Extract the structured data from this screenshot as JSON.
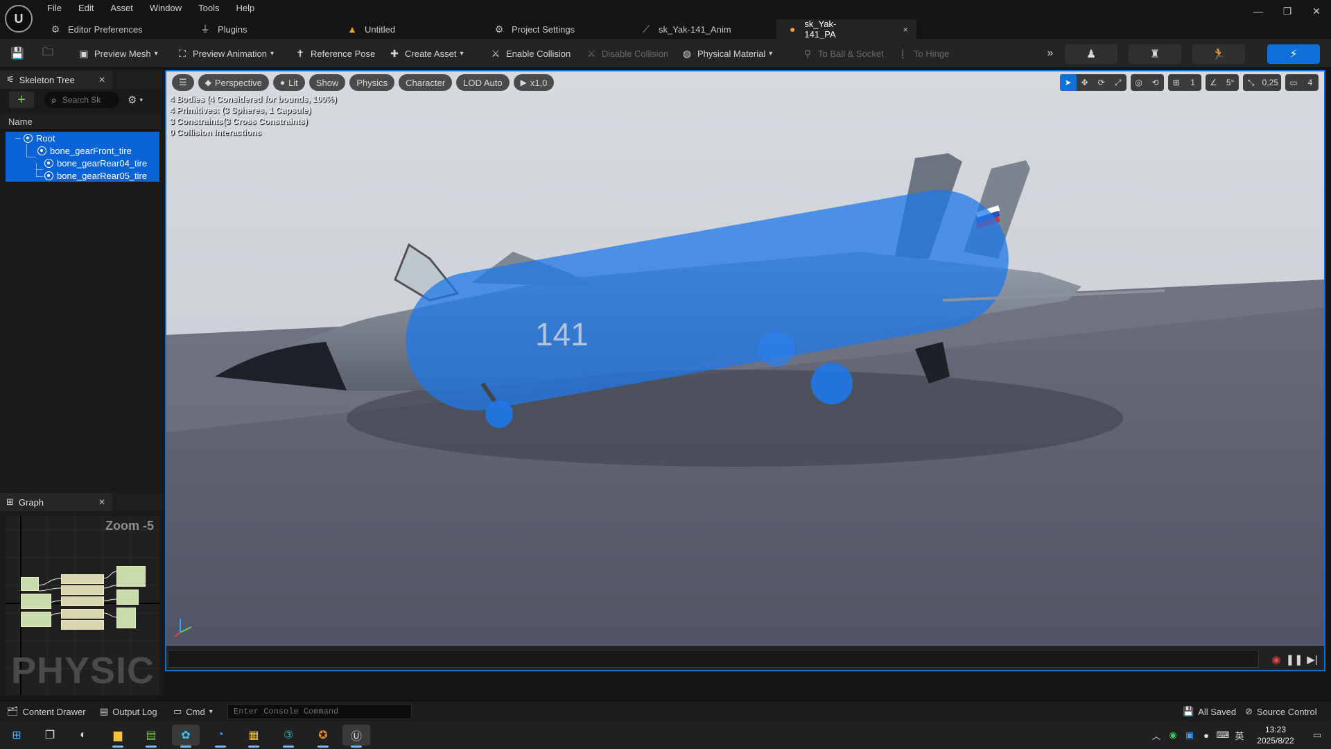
{
  "app": {
    "logo_letter": "U",
    "menu": [
      "File",
      "Edit",
      "Asset",
      "Window",
      "Tools",
      "Help"
    ],
    "tabs": [
      {
        "label": "Editor Preferences",
        "icon": "sliders-icon"
      },
      {
        "label": "Plugins",
        "icon": "plug-icon"
      },
      {
        "label": "Untitled",
        "icon": "level-icon"
      },
      {
        "label": "Project Settings",
        "icon": "gear-icon"
      },
      {
        "label": "sk_Yak-141_Anim",
        "icon": "anim-sequence-icon"
      },
      {
        "label": "sk_Yak-141_PA",
        "icon": "physics-asset-icon",
        "active": true
      }
    ],
    "tab_close": "×"
  },
  "toolbar": {
    "preview_mesh": "Preview Mesh",
    "preview_animation": "Preview Animation",
    "reference_pose": "Reference Pose",
    "create_asset": "Create Asset",
    "enable_collision": "Enable Collision",
    "disable_collision": "Disable Collision",
    "physical_material": "Physical Material",
    "to_ball_socket": "To Ball & Socket",
    "to_hinge": "To Hinge"
  },
  "skeleton_tree": {
    "tab_label": "Skeleton Tree",
    "search_placeholder": "Search Sk",
    "column_header": "Name",
    "bones": [
      {
        "name": "Root",
        "depth": 0
      },
      {
        "name": "bone_gearFront_tire",
        "depth": 1
      },
      {
        "name": "bone_gearRear04_tire",
        "depth": 2
      },
      {
        "name": "bone_gearRear05_tire",
        "depth": 2
      }
    ]
  },
  "graph": {
    "tab_label": "Graph",
    "zoom": "Zoom -5",
    "watermark": "PHYSIC"
  },
  "viewport": {
    "menu_glyph": "☰",
    "perspective": "Perspective",
    "lit": "Lit",
    "show": "Show",
    "physics": "Physics",
    "character": "Character",
    "lod": "LOD Auto",
    "speed": "x1,0",
    "grid_size": "1",
    "rotation_snap": "5°",
    "scale_snap": "0,25",
    "camera_speed": "4",
    "stats": [
      "4 Bodies (4 Considered for bounds, 100%)",
      "4 Primitives: (3 Spheres, 1 Capsule)",
      "3 Constraints(3 Cross Constraints)",
      "0 Collision Interactions"
    ],
    "fuselage_number": "141",
    "colors": {
      "sky": "#cfd3d8",
      "floor": "#5a5e6e",
      "collision_blue": "#1f78e8",
      "selection": "#0e70d8"
    }
  },
  "statusbar": {
    "content_drawer": "Content Drawer",
    "output_log": "Output Log",
    "cmd": "Cmd",
    "console_placeholder": "Enter Console Command",
    "all_saved": "All Saved",
    "source_control": "Source Control"
  },
  "taskbar": {
    "time": "13:23",
    "date": "2025/8/22",
    "ime": "英"
  }
}
